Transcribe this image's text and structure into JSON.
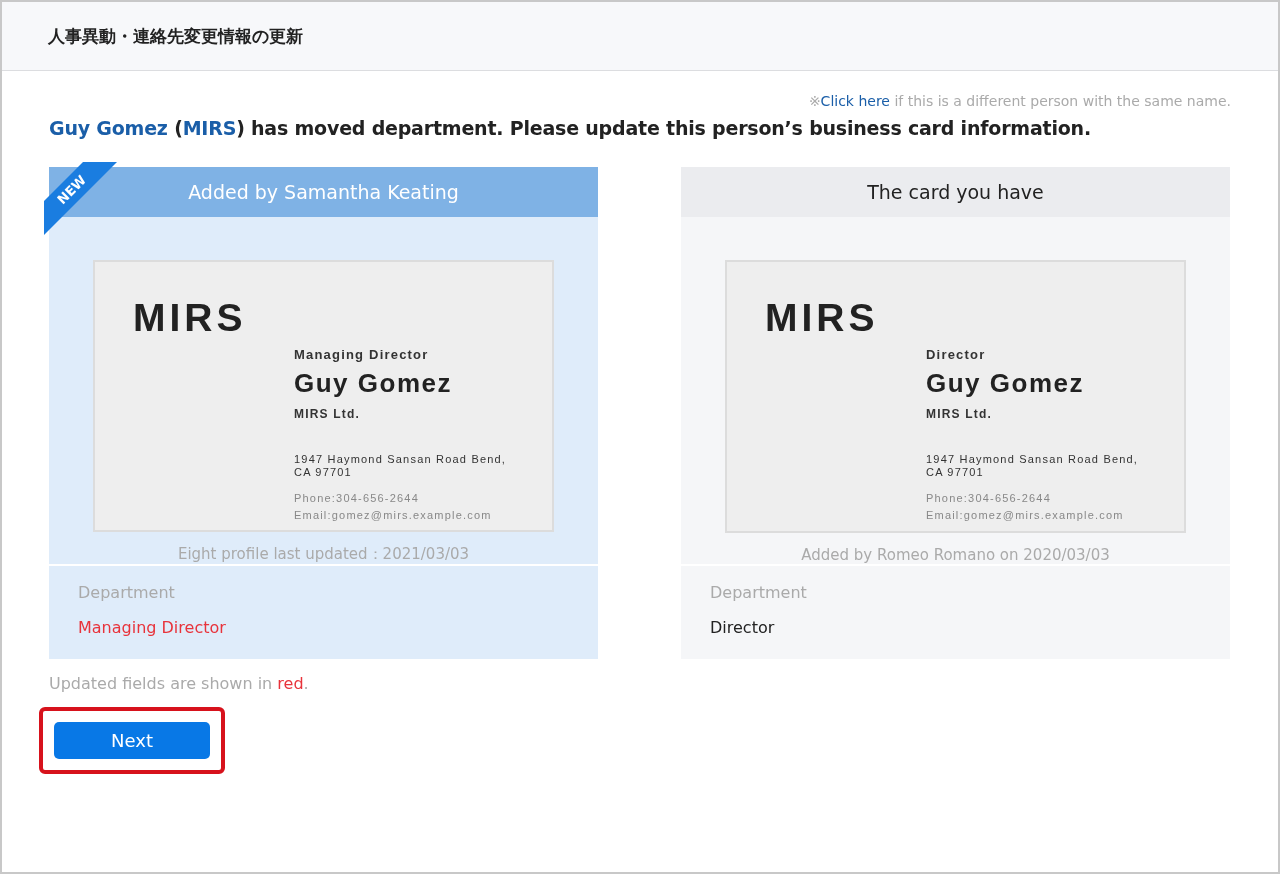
{
  "header": {
    "title": "人事異動・連絡先変更情報の更新"
  },
  "note": [
    {
      "kind": "text",
      "text": "※"
    },
    {
      "kind": "link",
      "text": "Click here"
    },
    {
      "kind": "text",
      "text": " if this is a different person with the same name."
    }
  ],
  "message": [
    {
      "kind": "link",
      "text": "Guy Gomez"
    },
    {
      "kind": "text",
      "text": " ("
    },
    {
      "kind": "link",
      "text": "MIRS"
    },
    {
      "kind": "text",
      "text": ") has moved department. Please update this person’s business card information."
    }
  ],
  "cards": [
    {
      "kind": "new",
      "badge": "NEW",
      "heading": "Added by Samantha Keating",
      "card": {
        "logo": "MIRS",
        "title": "Managing Director",
        "name": "Guy Gomez",
        "company": "MIRS Ltd.",
        "address": [
          "1947 Haymond Sansan Road Bend,",
          "CA 97701"
        ],
        "phone": "Phone:304-656-2644",
        "email": "Email:gomez@mirs.example.com"
      },
      "caption": "Eight profile last updated：2021/03/03",
      "field_label": "Department",
      "field_value": "Managing Director",
      "updated": true
    },
    {
      "kind": "current",
      "heading": "The card you have",
      "card": {
        "logo": "MIRS",
        "title": "Director",
        "name": "Guy Gomez",
        "company": "MIRS Ltd.",
        "address": [
          "1947 Haymond Sansan Road Bend,",
          "CA 97701"
        ],
        "phone": "Phone:304-656-2644",
        "email": "Email:gomez@mirs.example.com"
      },
      "caption": "Added by Romeo Romano on 2020/03/03",
      "field_label": "Department",
      "field_value": "Director",
      "updated": false
    }
  ],
  "legend": [
    {
      "kind": "text",
      "text": "Updated fields are shown in "
    },
    {
      "kind": "red",
      "text": "red"
    },
    {
      "kind": "text",
      "text": "."
    }
  ],
  "next_button": {
    "label": "Next",
    "highlighted": true
  }
}
